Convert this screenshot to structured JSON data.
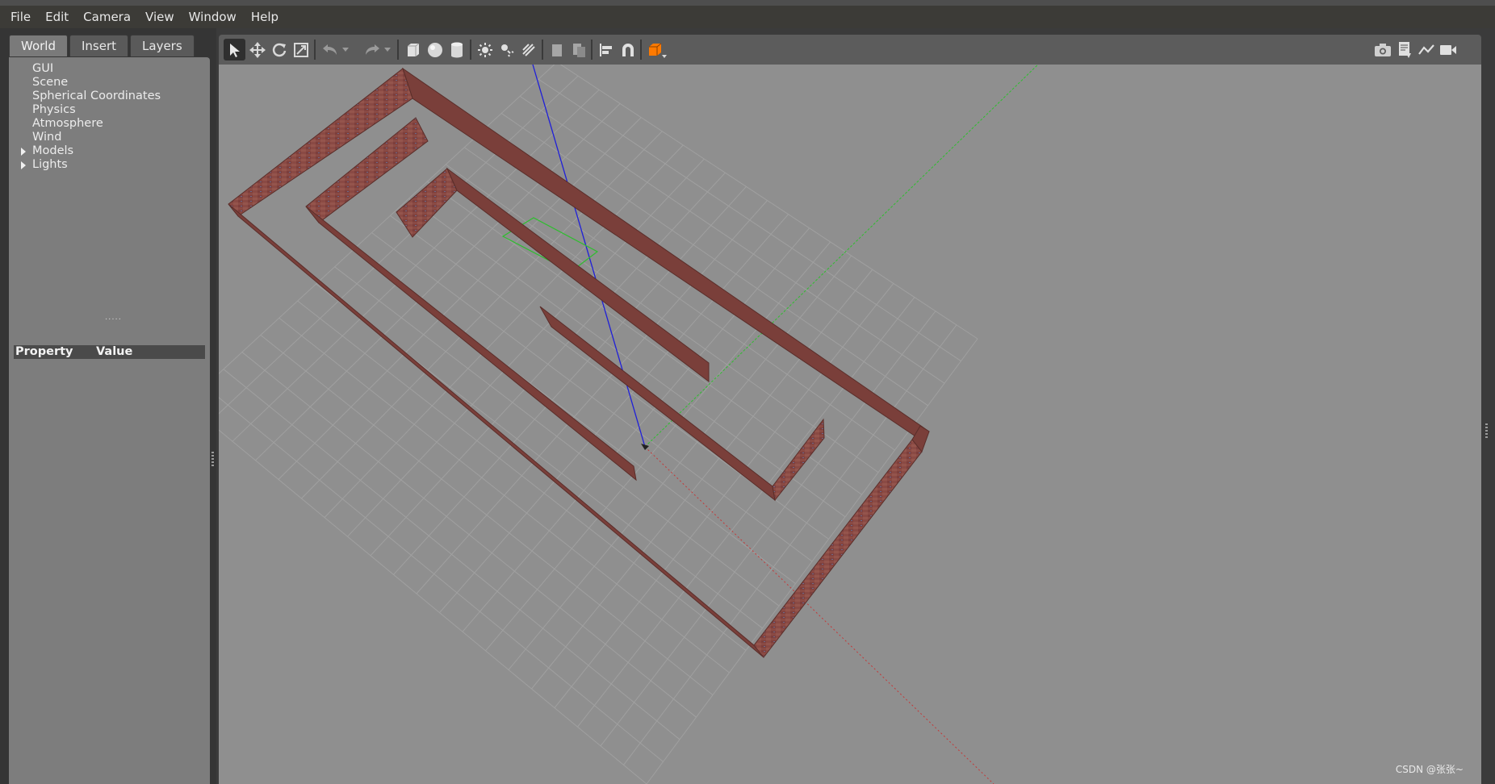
{
  "menu": [
    "File",
    "Edit",
    "Camera",
    "View",
    "Window",
    "Help"
  ],
  "tabs": [
    "World",
    "Insert",
    "Layers"
  ],
  "active_tab": "World",
  "tree_items": [
    {
      "label": "GUI",
      "expandable": false
    },
    {
      "label": "Scene",
      "expandable": false
    },
    {
      "label": "Spherical Coordinates",
      "expandable": false
    },
    {
      "label": "Physics",
      "expandable": false
    },
    {
      "label": "Atmosphere",
      "expandable": false
    },
    {
      "label": "Wind",
      "expandable": false
    },
    {
      "label": "Models",
      "expandable": true
    },
    {
      "label": "Lights",
      "expandable": true
    }
  ],
  "property_table": {
    "col1": "Property",
    "col2": "Value"
  },
  "toolbar": {
    "left": [
      "select-mode-icon",
      "translate-mode-icon",
      "rotate-mode-icon",
      "scale-mode-icon",
      "undo-icon",
      "undo-dropdown-icon",
      "redo-icon",
      "redo-dropdown-icon",
      "box-shape-icon",
      "sphere-shape-icon",
      "cylinder-shape-icon",
      "point-light-icon",
      "spot-light-icon",
      "directional-light-icon",
      "copy-icon",
      "paste-icon",
      "align-icon",
      "snap-icon",
      "view-angle-icon"
    ],
    "right": [
      "screenshot-icon",
      "log-data-icon",
      "plot-icon",
      "video-record-icon"
    ]
  },
  "colors": {
    "menubar": "#3c3b37",
    "panel": "#7d7d7d",
    "viewport": "#8f8f8f",
    "wall": "#8a4a42",
    "axis_x": "#c43838",
    "axis_y": "#2fbd2f",
    "axis_z": "#1f1fd8",
    "active_icon": "#ff7a00"
  },
  "watermark": "CSDN @张张~"
}
